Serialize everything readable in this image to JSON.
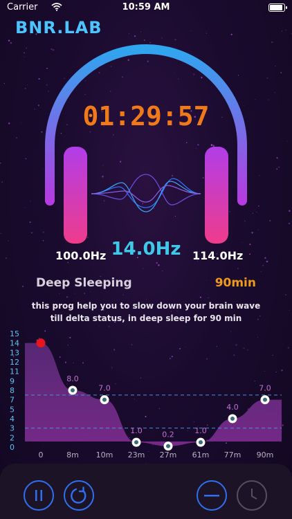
{
  "status_bar": {
    "carrier": "Carrier",
    "time": "10:59 AM",
    "battery_level": 0.9
  },
  "app": {
    "logo": "BNR.LAB"
  },
  "player": {
    "timer": "01:29:57",
    "left_freq": "100.0Hz",
    "beat_freq": "14.0Hz",
    "right_freq": "114.0Hz"
  },
  "program": {
    "title": "Deep Sleeping",
    "duration": "90min",
    "description": "this prog help you to slow down your brain  wave till delta status, in deep sleep for 90 min"
  },
  "chart_data": {
    "type": "area",
    "x": [
      "0",
      "8m",
      "10m",
      "23m",
      "27m",
      "61m",
      "77m",
      "90m"
    ],
    "values": [
      14.0,
      8.0,
      7.0,
      1.0,
      0.2,
      1.0,
      4.0,
      7.0
    ],
    "point_labels": [
      "",
      "8.0",
      "7.0",
      "1.0",
      "0.2",
      "1.0",
      "4.0",
      "7.0"
    ],
    "y_ticks": [
      "0",
      "2",
      "3",
      "4",
      "5",
      "7",
      "8",
      "9",
      "11",
      "12",
      "13",
      "14",
      "15"
    ],
    "reference_lines": [
      7.5,
      3.0
    ],
    "current_point_index": 0,
    "colors": {
      "area": "#7a2b8c",
      "line": "#4a90d9",
      "current": "#e8141e",
      "point": "#ffffff",
      "label": "#c070d0",
      "ytick": "#5cc4f0",
      "xtick": "#b8b2c4"
    }
  },
  "controls": {
    "pause_icon": "pause-icon",
    "restart_icon": "restart-icon",
    "minus_icon": "minus-icon",
    "clock_icon": "clock-icon"
  },
  "colors": {
    "accent_blue": "#2f6ff0",
    "orange": "#f07a1a",
    "cyan": "#3ec9e8",
    "logo": "#4cc4ff"
  }
}
